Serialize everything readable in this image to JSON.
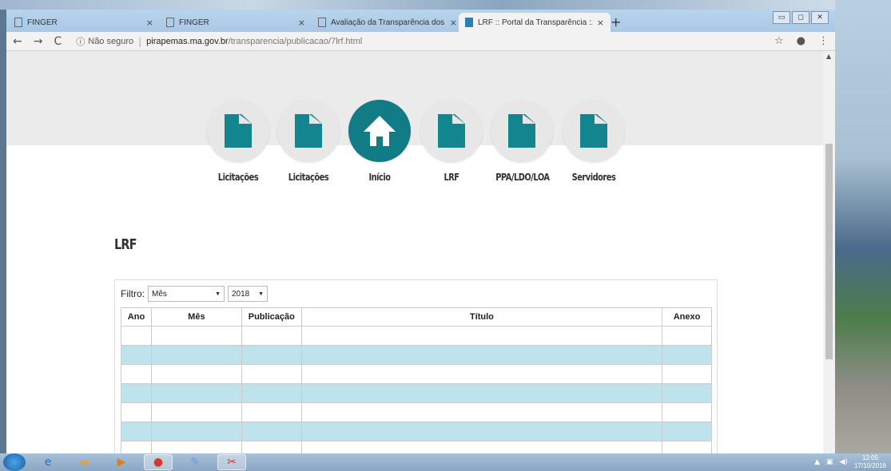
{
  "colors": {
    "accent": "#127c86",
    "row_alt": "#bfe3ec",
    "banner": "#ebebeb"
  },
  "browser": {
    "tabs": [
      {
        "title": "FINGER",
        "close": "×",
        "active": false
      },
      {
        "title": "FINGER",
        "close": "×",
        "active": false
      },
      {
        "title": "Avaliação da Transparência dos",
        "close": "×",
        "active": false
      },
      {
        "title": "LRF :: Portal da Transparência :: P",
        "close": "×",
        "active": true
      }
    ],
    "new_tab": "+",
    "window_controls": [
      "▭",
      "◻",
      "✕"
    ],
    "back": "←",
    "forward": "→",
    "reload": "C",
    "info_icon": "ⓘ",
    "security_label": "Não seguro",
    "url_separator": "|",
    "url_host": "pirapemas.ma.gov.br",
    "url_path": "/transparencia/publicacao/7lrf.html",
    "star": "☆",
    "profile": "●",
    "menu": "⋮"
  },
  "nav_menu": [
    {
      "label": "Licitações",
      "icon": "document-icon"
    },
    {
      "label": "Licitações",
      "icon": "document-icon"
    },
    {
      "label": "Início",
      "icon": "home-icon"
    },
    {
      "label": "LRF",
      "icon": "document-icon"
    },
    {
      "label": "PPA/LDO/LOA",
      "icon": "document-icon"
    },
    {
      "label": "Servidores",
      "icon": "document-icon"
    }
  ],
  "page": {
    "title": "LRF",
    "filter_label": "Filtro:",
    "filter_month": "Mês",
    "filter_year": "2018",
    "table": {
      "headers": [
        "Ano",
        "Mês",
        "Publicação",
        "Título",
        "Anexo"
      ],
      "rows": [
        [
          "",
          "",
          "",
          "",
          ""
        ],
        [
          "",
          "",
          "",
          "",
          ""
        ],
        [
          "",
          "",
          "",
          "",
          ""
        ],
        [
          "",
          "",
          "",
          "",
          ""
        ],
        [
          "",
          "",
          "",
          "",
          ""
        ],
        [
          "",
          "",
          "",
          "",
          ""
        ],
        [
          "",
          "",
          "",
          "",
          ""
        ]
      ]
    }
  },
  "taskbar": {
    "time": "12:05",
    "date": "17/10/2018"
  }
}
